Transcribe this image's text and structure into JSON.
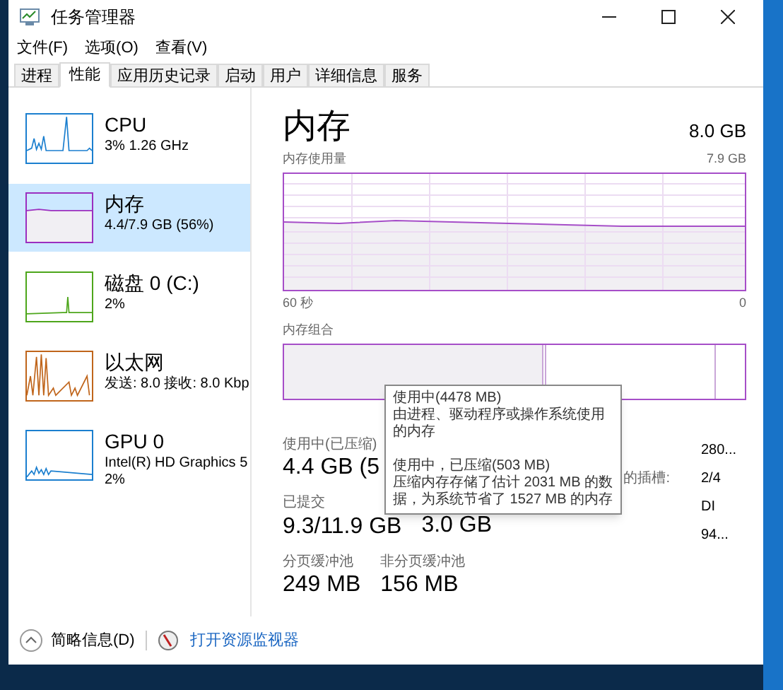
{
  "window": {
    "title": "任务管理器"
  },
  "menu": [
    "文件(F)",
    "选项(O)",
    "查看(V)"
  ],
  "tabs": [
    {
      "label": "进程",
      "selected": false
    },
    {
      "label": "性能",
      "selected": true
    },
    {
      "label": "应用历史记录",
      "selected": false
    },
    {
      "label": "启动",
      "selected": false
    },
    {
      "label": "用户",
      "selected": false
    },
    {
      "label": "详细信息",
      "selected": false
    },
    {
      "label": "服务",
      "selected": false
    }
  ],
  "sidebar": {
    "items": [
      {
        "name": "CPU",
        "details": [
          "3% 1.26 GHz"
        ],
        "color": "#1b7fcf",
        "selected": false
      },
      {
        "name": "内存",
        "details": [
          "4.4/7.9 GB (56%)"
        ],
        "color": "#9b2fc0",
        "selected": true
      },
      {
        "name": "磁盘 0 (C:)",
        "details": [
          "2%"
        ],
        "color": "#4da61b",
        "selected": false
      },
      {
        "name": "以太网",
        "details": [
          "发送: 8.0 接收: 8.0 Kbp"
        ],
        "color": "#c0651b",
        "selected": false
      },
      {
        "name": "GPU 0",
        "details": [
          "Intel(R) HD Graphics 5",
          "2%"
        ],
        "color": "#1b7fcf",
        "selected": false
      }
    ]
  },
  "main": {
    "title": "内存",
    "total": "8.0 GB",
    "usage_label": "内存使用量",
    "usage_max": "7.9 GB",
    "time_start": "60 秒",
    "time_end": "0",
    "composition_label": "内存组合",
    "stats": [
      [
        {
          "label": "使用中(已压缩)",
          "value": "4.4 GB (5"
        }
      ],
      [
        {
          "label": "已提交",
          "value": "9.3/11.9 GB"
        },
        {
          "value": "3.0 GB"
        }
      ],
      [
        {
          "label": "分页缓冲池",
          "value": "249 MB"
        },
        {
          "label": "非分页缓冲池",
          "value": "156 MB"
        }
      ]
    ],
    "specs": [
      {
        "value": "280..."
      },
      {
        "label": "的插槽:",
        "value": "2/4"
      },
      {
        "value": "DI"
      },
      {
        "value": "94..."
      }
    ]
  },
  "tooltip": {
    "sections": [
      {
        "title": "使用中(4478 MB)",
        "text": "由进程、驱动程序或操作系统使用的内存"
      },
      {
        "title": "使用中，已压缩(503 MB)",
        "text": "压缩内存存储了估计 2031 MB 的数据，为系统节省了 1527 MB 的内存"
      }
    ]
  },
  "footer": {
    "collapse": "简略信息(D)",
    "link": "打开资源监视器"
  }
}
